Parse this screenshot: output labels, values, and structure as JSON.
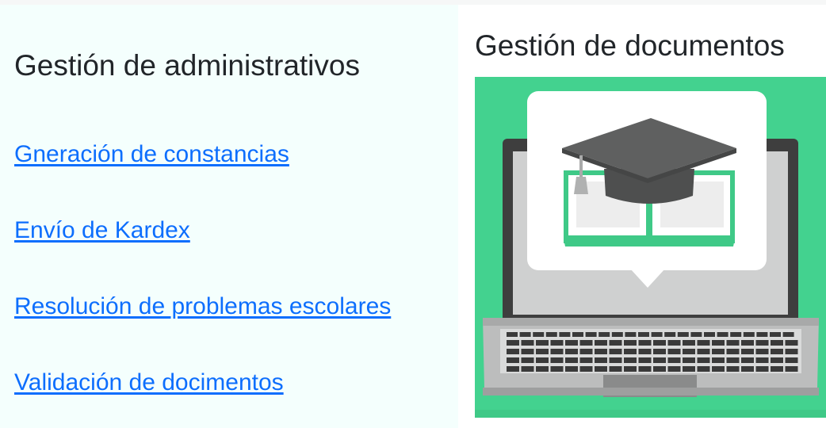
{
  "left": {
    "title": "Gestión de administrativos",
    "links": [
      "Gneración de constancias",
      "Envío de Kardex",
      "Resolución de problemas escolares",
      "Validación de docimentos"
    ]
  },
  "right": {
    "title": "Gestión de documentos",
    "illustration_icon": "laptop-graduation-cap-icon"
  },
  "colors": {
    "link": "#0d6efd",
    "heading": "#212529",
    "illustration_bg": "#43d28f"
  }
}
